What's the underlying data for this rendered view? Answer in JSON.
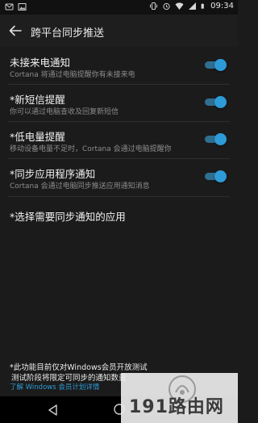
{
  "status_bar": {
    "time": "09:34",
    "left_icons": [
      "message-icon",
      "image-icon"
    ],
    "right_icons": [
      "vibrate-icon",
      "alarm-icon",
      "wifi-icon",
      "signal-icon",
      "battery-icon"
    ]
  },
  "app_bar": {
    "title": "跨平台同步推送"
  },
  "settings": [
    {
      "title": "未接来电通知",
      "subtitle": "Cortana 将通过电脑提醒你有未接来电",
      "toggle_on": true
    },
    {
      "title": "*新短信提醒",
      "subtitle": "你可以通过电脑查收及回复新短信",
      "toggle_on": true
    },
    {
      "title": "*低电量提醒",
      "subtitle": "移动设备电量不足时，Cortana 会通过电脑提醒你",
      "toggle_on": true
    },
    {
      "title": "*同步应用程序通知",
      "subtitle": "Cortana 会通过电脑同步推送应用通知消息",
      "toggle_on": true
    },
    {
      "title": "*选择需要同步通知的应用"
    }
  ],
  "footer": {
    "note_line1": "*此功能目前仅对Windows会员开放测试",
    "note_line2": "测试阶段将限定可同步的通知数量",
    "link": "了解 Windows 会员计划详情"
  },
  "watermark": {
    "text": "191路由网"
  },
  "colors": {
    "accent": "#2d9bd8",
    "background": "#1b1b1b"
  }
}
